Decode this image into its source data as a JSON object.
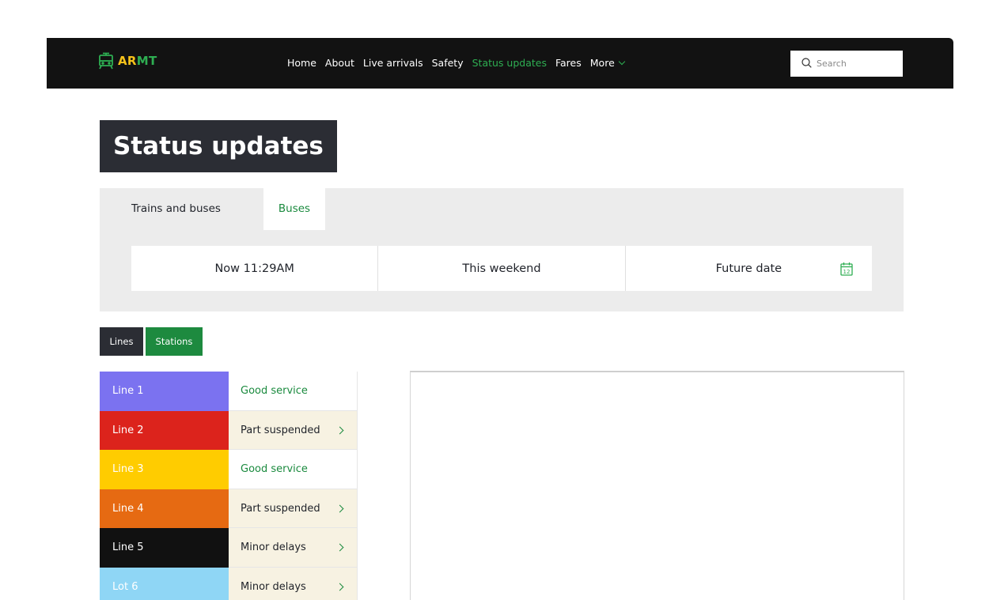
{
  "brand": {
    "letters": [
      "AR",
      "MT"
    ],
    "colors": {
      "ar": "#f6c21a",
      "mt": "#2eae52",
      "icon": "#2eae52"
    }
  },
  "nav": {
    "links": [
      {
        "label": "Home",
        "active": false
      },
      {
        "label": "About",
        "active": false
      },
      {
        "label": "Live arrivals",
        "active": false
      },
      {
        "label": "Safety",
        "active": false
      },
      {
        "label": "Status updates",
        "active": true
      },
      {
        "label": "Fares",
        "active": false
      }
    ],
    "more_label": "More",
    "search_placeholder": "Search"
  },
  "page_title": "Status updates",
  "mode_tabs": [
    {
      "label": "Trains and buses",
      "selected": false
    },
    {
      "label": "Buses",
      "selected": true
    }
  ],
  "time_options": [
    {
      "label": "Now 11:29AM"
    },
    {
      "label": "This weekend"
    },
    {
      "label": "Future date",
      "icon": "calendar-icon",
      "icon_text": "12"
    }
  ],
  "view_toggle": {
    "lines_label": "Lines",
    "stations_label": "Stations"
  },
  "lines": [
    {
      "name": "Line 1",
      "color": "#7b72f0",
      "text_color": "#ffffff",
      "status": "Good service",
      "status_type": "good"
    },
    {
      "name": "Line 2",
      "color": "#dc231c",
      "text_color": "#ffffff",
      "status": "Part suspended",
      "status_type": "warn"
    },
    {
      "name": "Line 3",
      "color": "#ffcc00",
      "text_color": "#ffffff",
      "status": "Good service",
      "status_type": "good"
    },
    {
      "name": "Line 4",
      "color": "#e66a12",
      "text_color": "#ffffff",
      "status": "Part suspended",
      "status_type": "warn"
    },
    {
      "name": "Line 5",
      "color": "#111111",
      "text_color": "#ffffff",
      "status": "Minor delays",
      "status_type": "warn"
    },
    {
      "name": "Lot 6",
      "color": "#8fd6f5",
      "text_color": "#ffffff",
      "status": "Minor delays",
      "status_type": "warn"
    }
  ]
}
